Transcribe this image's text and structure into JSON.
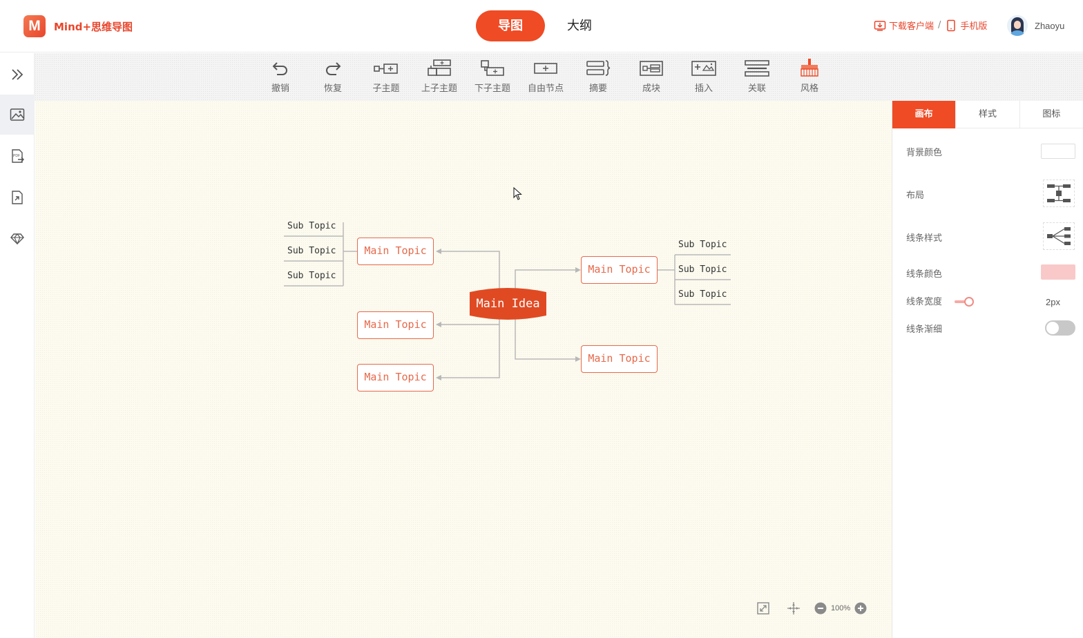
{
  "header": {
    "logo_letter": "M",
    "app_title": "Mind+思维导图",
    "mode_tabs": [
      {
        "label": "导图"
      },
      {
        "label": "大纲"
      }
    ],
    "download_label": "下载客户端",
    "separator": "/",
    "mobile_label": "手机版",
    "user_name": "Zhaoyu",
    "accent_color": "#ef4b25"
  },
  "toolbar": {
    "tools": [
      {
        "label": "撤销",
        "icon": "undo-icon"
      },
      {
        "label": "恢复",
        "icon": "redo-icon"
      },
      {
        "label": "子主题",
        "icon": "child-topic-icon"
      },
      {
        "label": "上子主题",
        "icon": "upper-topic-icon"
      },
      {
        "label": "下子主题",
        "icon": "lower-topic-icon"
      },
      {
        "label": "自由节点",
        "icon": "free-node-icon"
      },
      {
        "label": "摘要",
        "icon": "summary-icon"
      },
      {
        "label": "成块",
        "icon": "block-icon"
      },
      {
        "label": "插入",
        "icon": "insert-icon"
      },
      {
        "label": "关联",
        "icon": "relation-icon"
      },
      {
        "label": "风格",
        "icon": "style-brush-icon"
      }
    ]
  },
  "sidebar": {
    "items": [
      {
        "icon": "expand-chevrons-icon"
      },
      {
        "icon": "image-export-icon"
      },
      {
        "icon": "pdf-export-icon"
      },
      {
        "icon": "file-export-icon"
      },
      {
        "icon": "sketch-export-icon"
      }
    ]
  },
  "mindmap": {
    "center": "Main Idea",
    "main_topics": [
      {
        "label": "Main Topic",
        "subs": [
          "Sub Topic",
          "Sub Topic",
          "Sub Topic"
        ]
      },
      {
        "label": "Main Topic",
        "subs": [
          "Sub Topic",
          "Sub Topic",
          "Sub Topic"
        ]
      },
      {
        "label": "Main Topic",
        "subs": []
      },
      {
        "label": "Main Topic",
        "subs": []
      },
      {
        "label": "Main Topic",
        "subs": []
      }
    ],
    "line_color": "#b8b8b8",
    "topic_color": "#e8684a",
    "center_color": "#e04a23"
  },
  "zoom": {
    "level": "100%"
  },
  "panel": {
    "tabs": [
      {
        "label": "画布"
      },
      {
        "label": "样式"
      },
      {
        "label": "图标"
      }
    ],
    "background_color_label": "背景颜色",
    "background_color": "#ffffff",
    "layout_label": "布局",
    "line_style_label": "线条样式",
    "line_color_label": "线条颜色",
    "line_color": "#f9c9c9",
    "line_width_label": "线条宽度",
    "line_width_value": "2px",
    "line_taper_label": "线条渐细",
    "line_taper_on": false
  }
}
